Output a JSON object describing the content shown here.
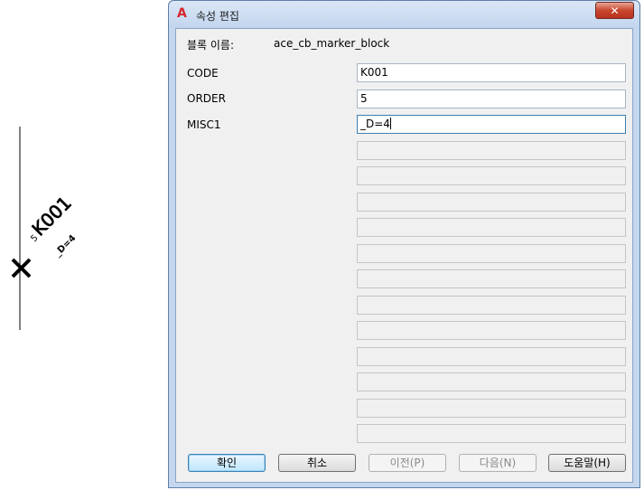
{
  "canvas": {
    "attribute_code": "K001",
    "attribute_order": "5",
    "attribute_misc": "_D=4",
    "marker_icon": "x-marker-icon"
  },
  "dialog": {
    "title": "속성 편집",
    "app_icon": "autocad-logo-icon",
    "close_icon": "close-icon",
    "block_name_label": "블록 이름:",
    "block_name_value": "ace_cb_marker_block",
    "attributes": [
      {
        "label": "CODE",
        "value": "K001"
      },
      {
        "label": "ORDER",
        "value": "5"
      },
      {
        "label": "MISC1",
        "value": "_D=4"
      }
    ],
    "empty_fields": 12,
    "buttons": {
      "ok": "확인",
      "cancel": "취소",
      "previous": "이전(P)",
      "next": "다음(N)",
      "help": "도움말(H)"
    }
  }
}
